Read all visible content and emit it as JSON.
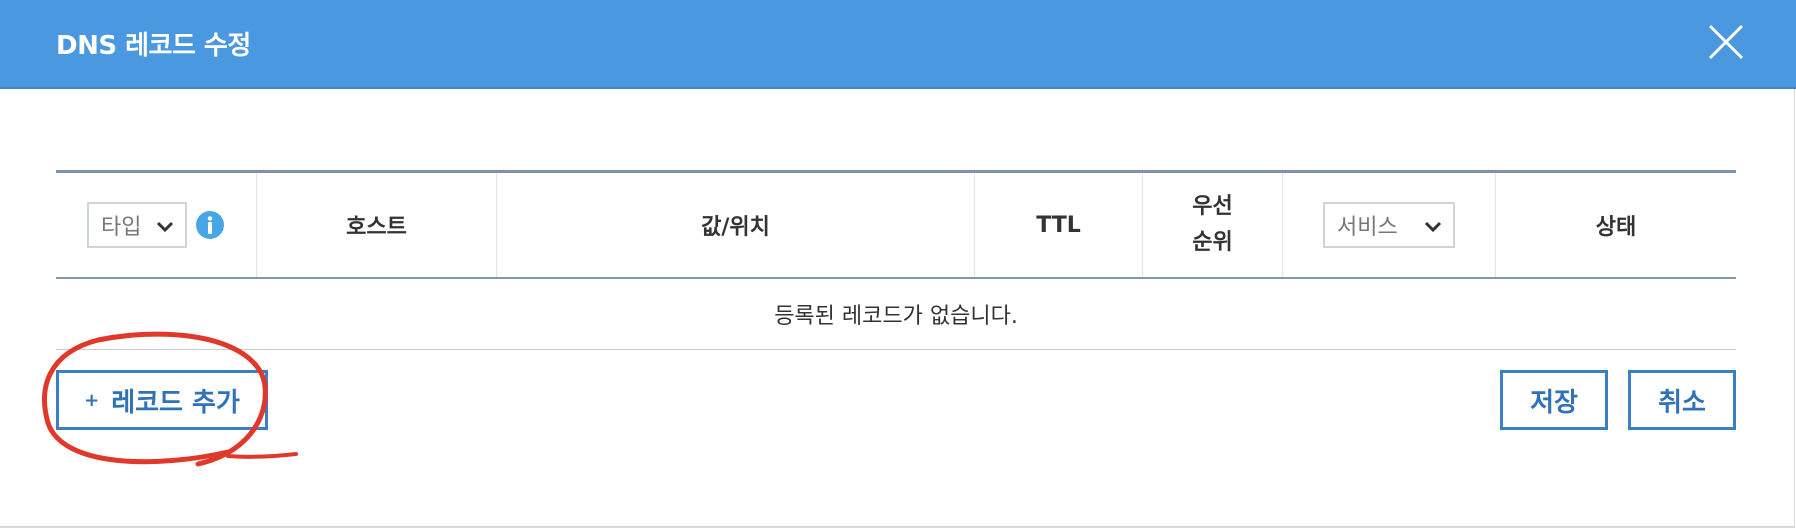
{
  "dialog": {
    "title": "DNS 레코드 수정",
    "close_icon": "close-icon"
  },
  "table": {
    "type_select": {
      "value": "타입",
      "icon": "chevron-down-icon"
    },
    "info_icon": "info-icon",
    "columns": {
      "host": "호스트",
      "value": "값/위치",
      "ttl": "TTL",
      "priority_line1": "우선",
      "priority_line2": "순위"
    },
    "service_select": {
      "value": "서비스",
      "icon": "chevron-down-icon"
    },
    "status": "상태",
    "empty_message": "등록된 레코드가 없습니다."
  },
  "actions": {
    "add_plus": "+",
    "add_label": "레코드 추가",
    "save_label": "저장",
    "cancel_label": "취소"
  },
  "colors": {
    "header_bg": "#4a98e0",
    "button_border": "#3a7fc6",
    "annotation": "#e0392b"
  }
}
